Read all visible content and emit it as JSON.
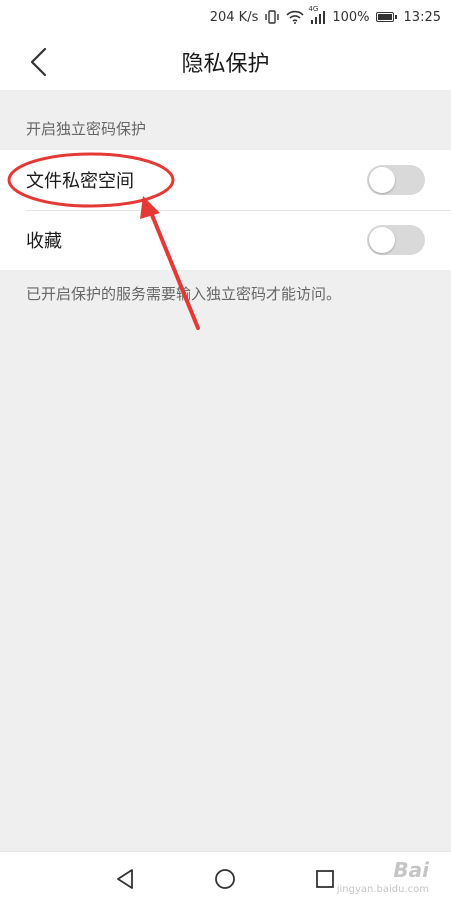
{
  "status_bar": {
    "speed": "204 K/s",
    "network": "4G",
    "battery": "100%",
    "time": "13:25"
  },
  "header": {
    "title": "隐私保护"
  },
  "section": {
    "label": "开启独立密码保护"
  },
  "items": [
    {
      "label": "文件私密空间",
      "enabled": false
    },
    {
      "label": "收藏",
      "enabled": false
    }
  ],
  "footnote": "已开启保护的服务需要输入独立密码才能访问。",
  "annotation": {
    "color": "#e53935"
  },
  "watermark": {
    "text": "Bai",
    "sub": "jingyan.baidu.com"
  }
}
